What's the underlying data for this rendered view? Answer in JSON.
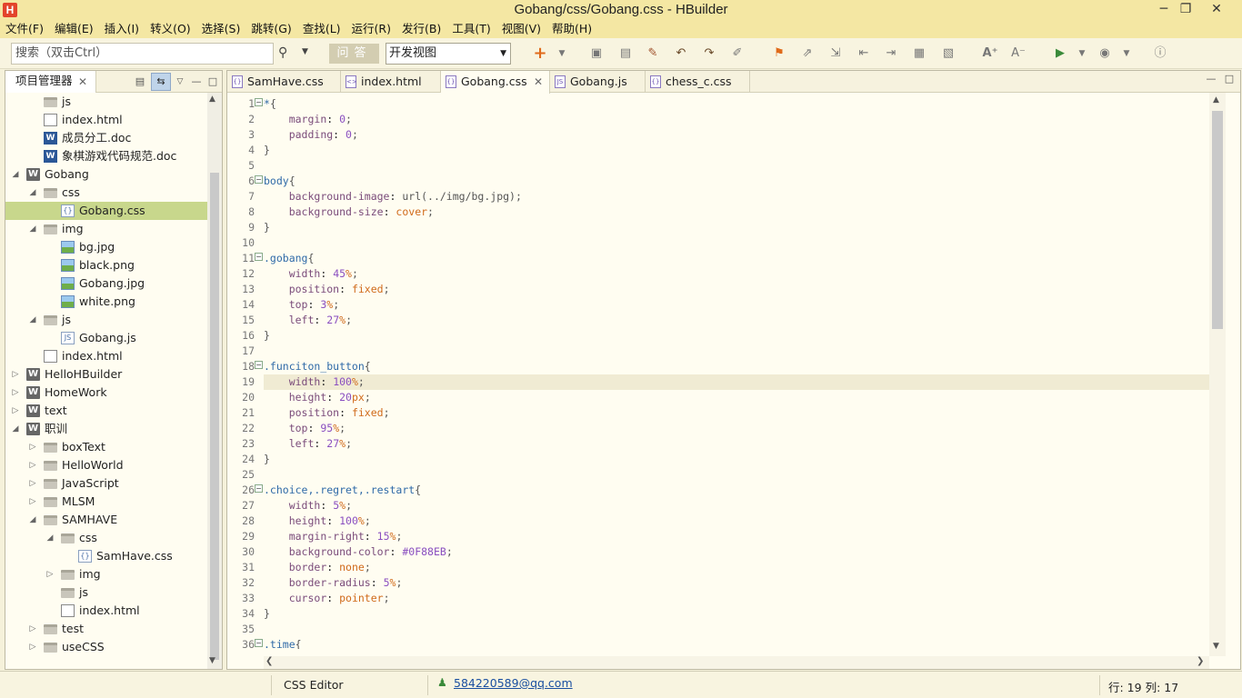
{
  "window": {
    "title": "Gobang/css/Gobang.css  -  HBuilder",
    "logo": "H",
    "minimize": "─",
    "maximize": "❐",
    "close": "✕"
  },
  "menu": [
    "文件(F)",
    "编辑(E)",
    "插入(I)",
    "转义(O)",
    "选择(S)",
    "跳转(G)",
    "查找(L)",
    "运行(R)",
    "发行(B)",
    "工具(T)",
    "视图(V)",
    "帮助(H)"
  ],
  "toolbar": {
    "search_placeholder": "搜索（双击Ctrl）",
    "ask_label": "问答",
    "view_select": "开发视图"
  },
  "project_panel": {
    "tab_label": "项目管理器",
    "tree": [
      {
        "label": "js",
        "icon": "folder",
        "level": 2,
        "twisty": ""
      },
      {
        "label": "index.html",
        "icon": "web",
        "level": 2,
        "twisty": ""
      },
      {
        "label": "成员分工.doc",
        "icon": "word",
        "level": 2,
        "twisty": ""
      },
      {
        "label": "象棋游戏代码规范.doc",
        "icon": "word",
        "level": 2,
        "twisty": ""
      },
      {
        "label": "Gobang",
        "icon": "project",
        "level": 1,
        "twisty": "open"
      },
      {
        "label": "css",
        "icon": "folder",
        "level": 2,
        "twisty": "open"
      },
      {
        "label": "Gobang.css",
        "icon": "css",
        "level": 3,
        "twisty": "",
        "selected": true
      },
      {
        "label": "img",
        "icon": "folder",
        "level": 2,
        "twisty": "open"
      },
      {
        "label": "bg.jpg",
        "icon": "image",
        "level": 3,
        "twisty": ""
      },
      {
        "label": "black.png",
        "icon": "image",
        "level": 3,
        "twisty": ""
      },
      {
        "label": "Gobang.jpg",
        "icon": "image",
        "level": 3,
        "twisty": ""
      },
      {
        "label": "white.png",
        "icon": "image",
        "level": 3,
        "twisty": ""
      },
      {
        "label": "js",
        "icon": "folder",
        "level": 2,
        "twisty": "open"
      },
      {
        "label": "Gobang.js",
        "icon": "js",
        "level": 3,
        "twisty": ""
      },
      {
        "label": "index.html",
        "icon": "web",
        "level": 2,
        "twisty": ""
      },
      {
        "label": "HelloHBuilder",
        "icon": "project",
        "level": 1,
        "twisty": "closed"
      },
      {
        "label": "HomeWork",
        "icon": "project",
        "level": 1,
        "twisty": "closed"
      },
      {
        "label": "text",
        "icon": "project",
        "level": 1,
        "twisty": "closed"
      },
      {
        "label": "职训",
        "icon": "project",
        "level": 1,
        "twisty": "open"
      },
      {
        "label": "boxText",
        "icon": "folder",
        "level": 2,
        "twisty": "closed"
      },
      {
        "label": "HelloWorld",
        "icon": "folder",
        "level": 2,
        "twisty": "closed"
      },
      {
        "label": "JavaScript",
        "icon": "folder",
        "level": 2,
        "twisty": "closed"
      },
      {
        "label": "MLSM",
        "icon": "folder",
        "level": 2,
        "twisty": "closed"
      },
      {
        "label": "SAMHAVE",
        "icon": "folder",
        "level": 2,
        "twisty": "open"
      },
      {
        "label": "css",
        "icon": "folder",
        "level": 3,
        "twisty": "open"
      },
      {
        "label": "SamHave.css",
        "icon": "css",
        "level": 4,
        "twisty": ""
      },
      {
        "label": "img",
        "icon": "folder",
        "level": 3,
        "twisty": "closed"
      },
      {
        "label": "js",
        "icon": "folder",
        "level": 3,
        "twisty": ""
      },
      {
        "label": "index.html",
        "icon": "web",
        "level": 3,
        "twisty": ""
      },
      {
        "label": "test",
        "icon": "folder",
        "level": 2,
        "twisty": "closed"
      },
      {
        "label": "useCSS",
        "icon": "folder",
        "level": 2,
        "twisty": "closed"
      }
    ]
  },
  "editor": {
    "tabs": [
      {
        "label": "SamHave.css",
        "icon": "css",
        "active": false
      },
      {
        "label": "index.html",
        "icon": "html",
        "active": false
      },
      {
        "label": "Gobang.css",
        "icon": "css",
        "active": true
      },
      {
        "label": "Gobang.js",
        "icon": "js",
        "active": false
      },
      {
        "label": "chess_c.css",
        "icon": "css",
        "active": false
      }
    ],
    "current_line": 19,
    "fold_lines": [
      1,
      6,
      11,
      18,
      26,
      36
    ],
    "lines": [
      "*{",
      "    margin: 0;",
      "    padding: 0;",
      "}",
      "",
      "body{",
      "    background-image: url(../img/bg.jpg);",
      "    background-size: cover;",
      "}",
      "",
      ".gobang{",
      "    width: 45%;",
      "    position: fixed;",
      "    top: 3%;",
      "    left: 27%;",
      "}",
      "",
      ".funciton_button{",
      "    width: 100%;",
      "    height: 20px;",
      "    position: fixed;",
      "    top: 95%;",
      "    left: 27%;",
      "}",
      "",
      ".choice,.regret,.restart{",
      "    width: 5%;",
      "    height: 100%;",
      "    margin-right: 15%;",
      "    background-color: #0F88EB;",
      "    border: none;",
      "    border-radius: 5%;",
      "    cursor: pointer;",
      "}",
      "",
      ".time{"
    ]
  },
  "status": {
    "editor_type": "CSS Editor",
    "user": "584220589@qq.com",
    "position": "行: 19 列: 17"
  }
}
